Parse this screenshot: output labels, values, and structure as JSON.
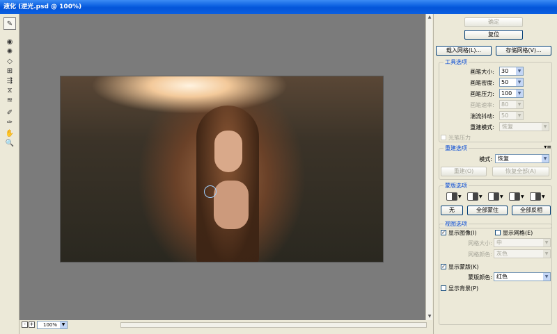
{
  "window": {
    "title": "液化 (逆光.psd @ 100%)"
  },
  "toolbar": {
    "tools": [
      {
        "name": "forward-warp-tool-icon",
        "glyph": "✎"
      },
      {
        "name": "reconstruct-tool-icon",
        "glyph": "◉"
      },
      {
        "name": "twirl-tool-icon",
        "glyph": "✺"
      },
      {
        "name": "pucker-tool-icon",
        "glyph": "◇"
      },
      {
        "name": "bloat-tool-icon",
        "glyph": "⊞"
      },
      {
        "name": "push-left-tool-icon",
        "glyph": "⇶"
      },
      {
        "name": "mirror-tool-icon",
        "glyph": "⧖"
      },
      {
        "name": "turbulence-tool-icon",
        "glyph": "≋"
      },
      {
        "name": "freeze-mask-tool-icon",
        "glyph": "✐"
      },
      {
        "name": "thaw-mask-tool-icon",
        "glyph": "✑"
      },
      {
        "name": "hand-tool-icon",
        "glyph": "✋"
      },
      {
        "name": "zoom-tool-icon",
        "glyph": "🔍"
      }
    ]
  },
  "canvas": {
    "zoom": "100%",
    "zoom_in": "+",
    "zoom_out": "-"
  },
  "panel": {
    "ok": "确定",
    "reset": "复位",
    "load_mesh": "载入网格(L)...",
    "save_mesh": "存储网格(V)...",
    "tool_options": {
      "title": "工具选项",
      "brush_size_label": "画笔大小:",
      "brush_size": "30",
      "brush_density_label": "画笔密度:",
      "brush_density": "50",
      "brush_pressure_label": "画笔压力:",
      "brush_pressure": "100",
      "brush_rate_label": "画笔速率:",
      "brush_rate": "80",
      "turbulent_jitter_label": "湍流抖动:",
      "turbulent_jitter": "50",
      "reconstruct_mode_label": "重建模式:",
      "reconstruct_mode": "恢复",
      "stylus_pressure": "光笔压力"
    },
    "reconstruct_options": {
      "title": "重建选项",
      "mode_label": "模式:",
      "mode": "恢复",
      "reconstruct": "重建(O)",
      "restore_all": "恢复全部(A)"
    },
    "mask_options": {
      "title": "蒙版选项",
      "none": "无",
      "mask_all": "全部蒙住",
      "invert_all": "全部反相"
    },
    "view_options": {
      "title": "视图选项",
      "show_image": "显示图像(I)",
      "show_mesh": "显示网格(E)",
      "mesh_size_label": "网格大小:",
      "mesh_size": "中",
      "mesh_color_label": "网格颜色:",
      "mesh_color": "灰色",
      "show_mask": "显示蒙版(K)",
      "mask_color_label": "蒙版颜色:",
      "mask_color": "红色",
      "show_backdrop": "显示背景(P)"
    }
  },
  "colors": {
    "accent": "#0046d5",
    "title_bar": "#0a5fe0",
    "canvas_bg": "#7b7b7b",
    "panel_bg": "#ece9d8"
  }
}
